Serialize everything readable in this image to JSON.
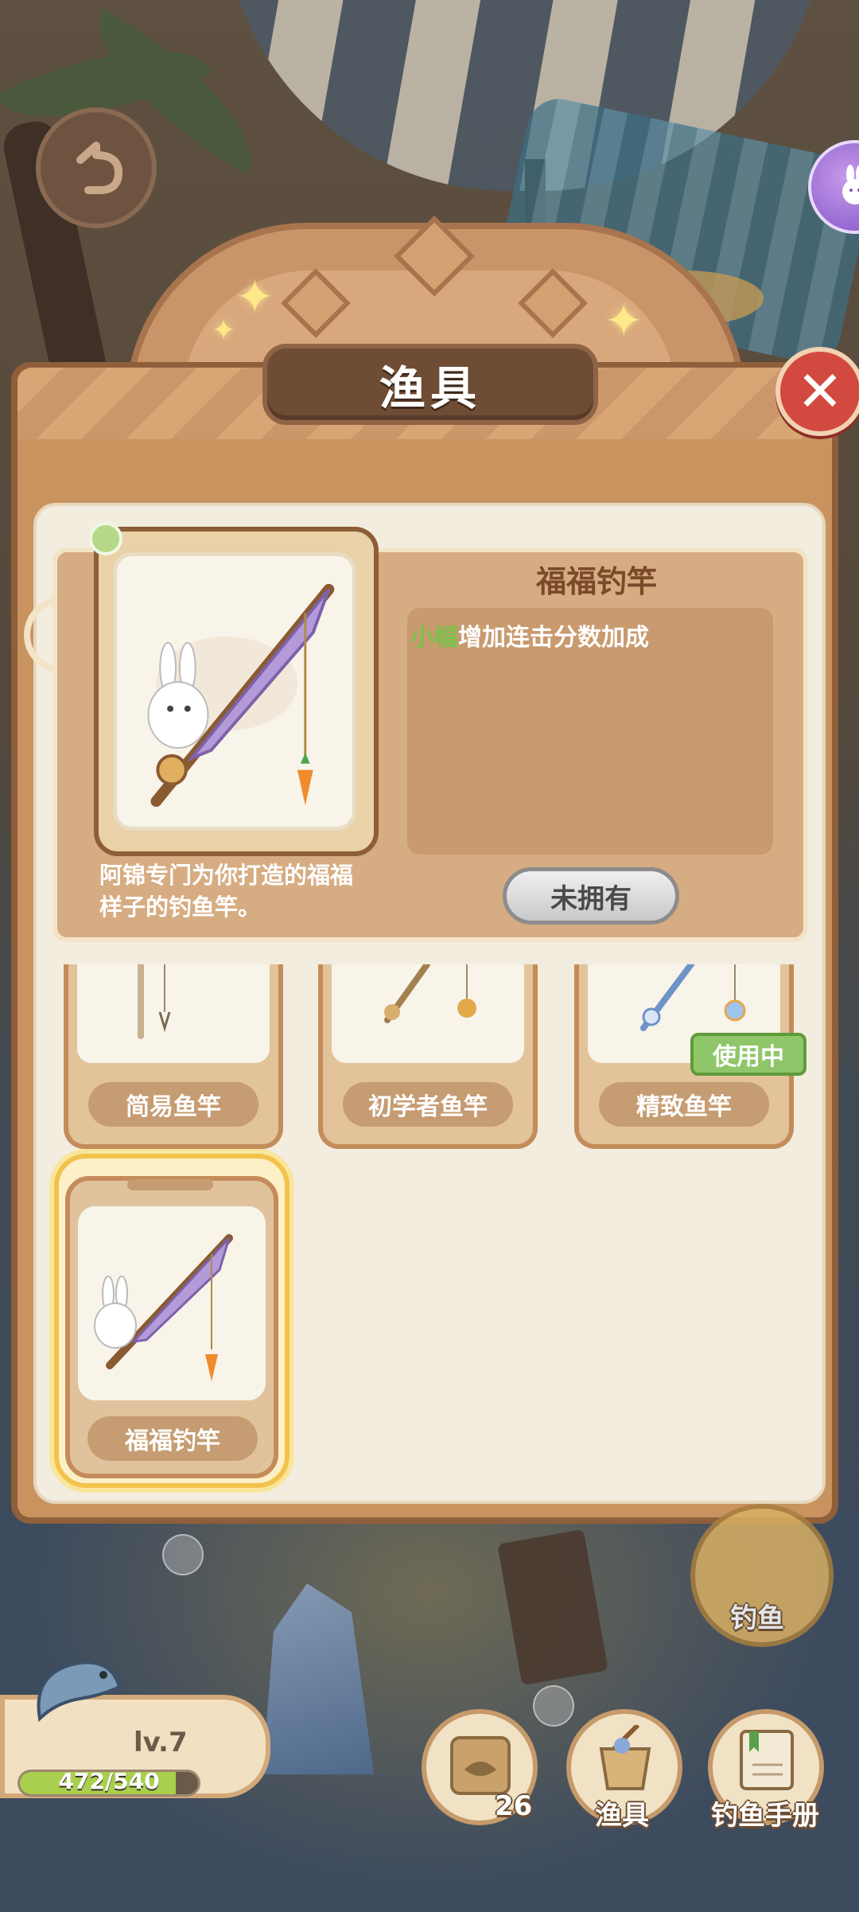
{
  "modal": {
    "title": "渔具",
    "close_symbol": "✕",
    "selected_item": {
      "name": "福福钓竿",
      "effect_level": "小幅",
      "effect_text": "增加连击分数加成",
      "description": "阿锦专门为你打造的福福样子的钓鱼竿。",
      "ownership_button": "未拥有"
    },
    "items": [
      {
        "label": "简易鱼竿"
      },
      {
        "label": "初学者鱼竿"
      },
      {
        "label": "精致鱼竿",
        "badge": "使用中"
      },
      {
        "label": "福福钓竿"
      }
    ]
  },
  "hud": {
    "level": "lv.7",
    "xp_text": "472/540",
    "xp_fraction": 0.874,
    "buttons": [
      {
        "name": "bait",
        "label": "",
        "count": "26"
      },
      {
        "name": "gear",
        "label": "渔具"
      },
      {
        "name": "manual",
        "label": "钓鱼手册"
      }
    ],
    "fish_button": "钓鱼"
  },
  "colors": {
    "accent_green": "#79c24a",
    "close_red": "#d24a3f",
    "gold_selection": "#f2c24c"
  }
}
